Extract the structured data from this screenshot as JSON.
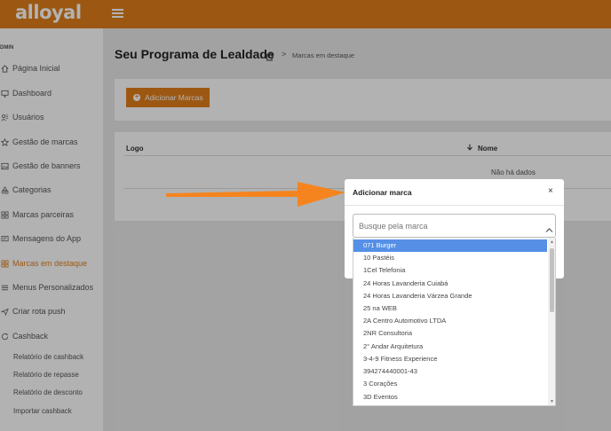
{
  "app": {
    "logo_text": "alloyal"
  },
  "sidebar": {
    "section_label": "DMIN",
    "items": [
      {
        "label": "Página Inicial",
        "icon": "home-icon"
      },
      {
        "label": "Dashboard",
        "icon": "monitor-icon"
      },
      {
        "label": "Usuários",
        "icon": "users-icon"
      },
      {
        "label": "Gestão de marcas",
        "icon": "star-icon"
      },
      {
        "label": "Gestão de banners",
        "icon": "image-icon"
      },
      {
        "label": "Categorias",
        "icon": "categories-icon"
      },
      {
        "label": "Marcas parceiras",
        "icon": "grid-icon"
      },
      {
        "label": "Mensagens do App",
        "icon": "message-icon"
      },
      {
        "label": "Marcas em destaque",
        "icon": "grid-icon",
        "active": true
      },
      {
        "label": "Menus Personalizados",
        "icon": "menu-icon"
      },
      {
        "label": "Criar rota push",
        "icon": "send-icon"
      },
      {
        "label": "Cashback",
        "icon": "cashback-icon"
      }
    ],
    "subitems": [
      {
        "label": "Relatório de cashback"
      },
      {
        "label": "Relatório de repasse"
      },
      {
        "label": "Relatório de desconto"
      },
      {
        "label": "Importar cashback"
      }
    ]
  },
  "header": {
    "title": "Seu Programa de Lealdade",
    "breadcrumb_sep": ">",
    "breadcrumb": "Marcas em destaque"
  },
  "toolbar": {
    "add_label": "Adicionar Marcas",
    "add_icon": "+"
  },
  "table": {
    "columns": [
      "Logo",
      "Nome"
    ],
    "sort_icon": "sort-down-icon",
    "empty_text": "Não há dados"
  },
  "modal": {
    "title": "Adicionar marca",
    "close_glyph": "×",
    "select": {
      "placeholder": "Busque pela marca",
      "options": [
        "071 Burger",
        "10 Pastéis",
        "1Cel Telefonia",
        "24 Horas Lavanderia Cuiabá",
        "24 Horas Lavanderia Várzea Grande",
        "25 na WEB",
        "2A Centro Automotivo LTDA",
        "2NR Consultoria",
        "2° Andar Arquitetura",
        "3-4-9 Fitness Experience",
        "394274440001-43",
        "3 Corações",
        "3D Eventos"
      ],
      "highlighted_index": 0
    }
  },
  "colors": {
    "brand": "#e07e1b",
    "highlight": "#5590e6",
    "annotation_arrow": "#f5841f"
  }
}
